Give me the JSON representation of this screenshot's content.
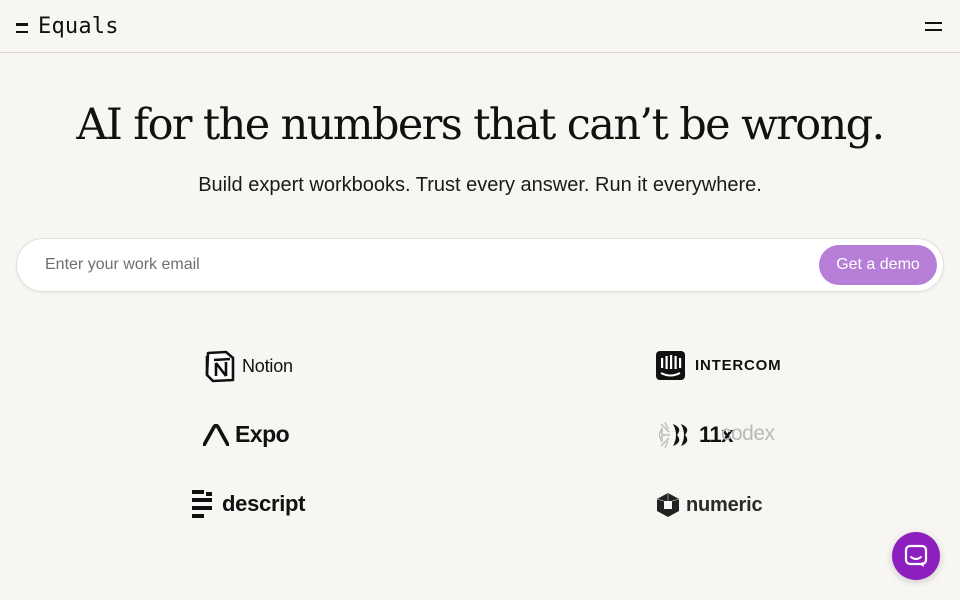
{
  "header": {
    "brand": "Equals",
    "menu_icon": "hamburger-menu-icon"
  },
  "hero": {
    "headline": "AI for the numbers that can’t be wrong.",
    "subheadline": "Build expert workbooks. Trust every answer. Run it everywhere."
  },
  "signup": {
    "email_placeholder": "Enter your work email",
    "email_value": "",
    "cta_label": "Get a demo",
    "cta_color": "#b67ed6"
  },
  "customer_logos": {
    "left": [
      "Notion",
      "Expo",
      "descript"
    ],
    "right": [
      "INTERCOM",
      "11x",
      "numeric"
    ],
    "right_faded_overlay": "codex"
  },
  "chat": {
    "icon": "chat-bubble-icon",
    "color": "#8e1fbf"
  }
}
